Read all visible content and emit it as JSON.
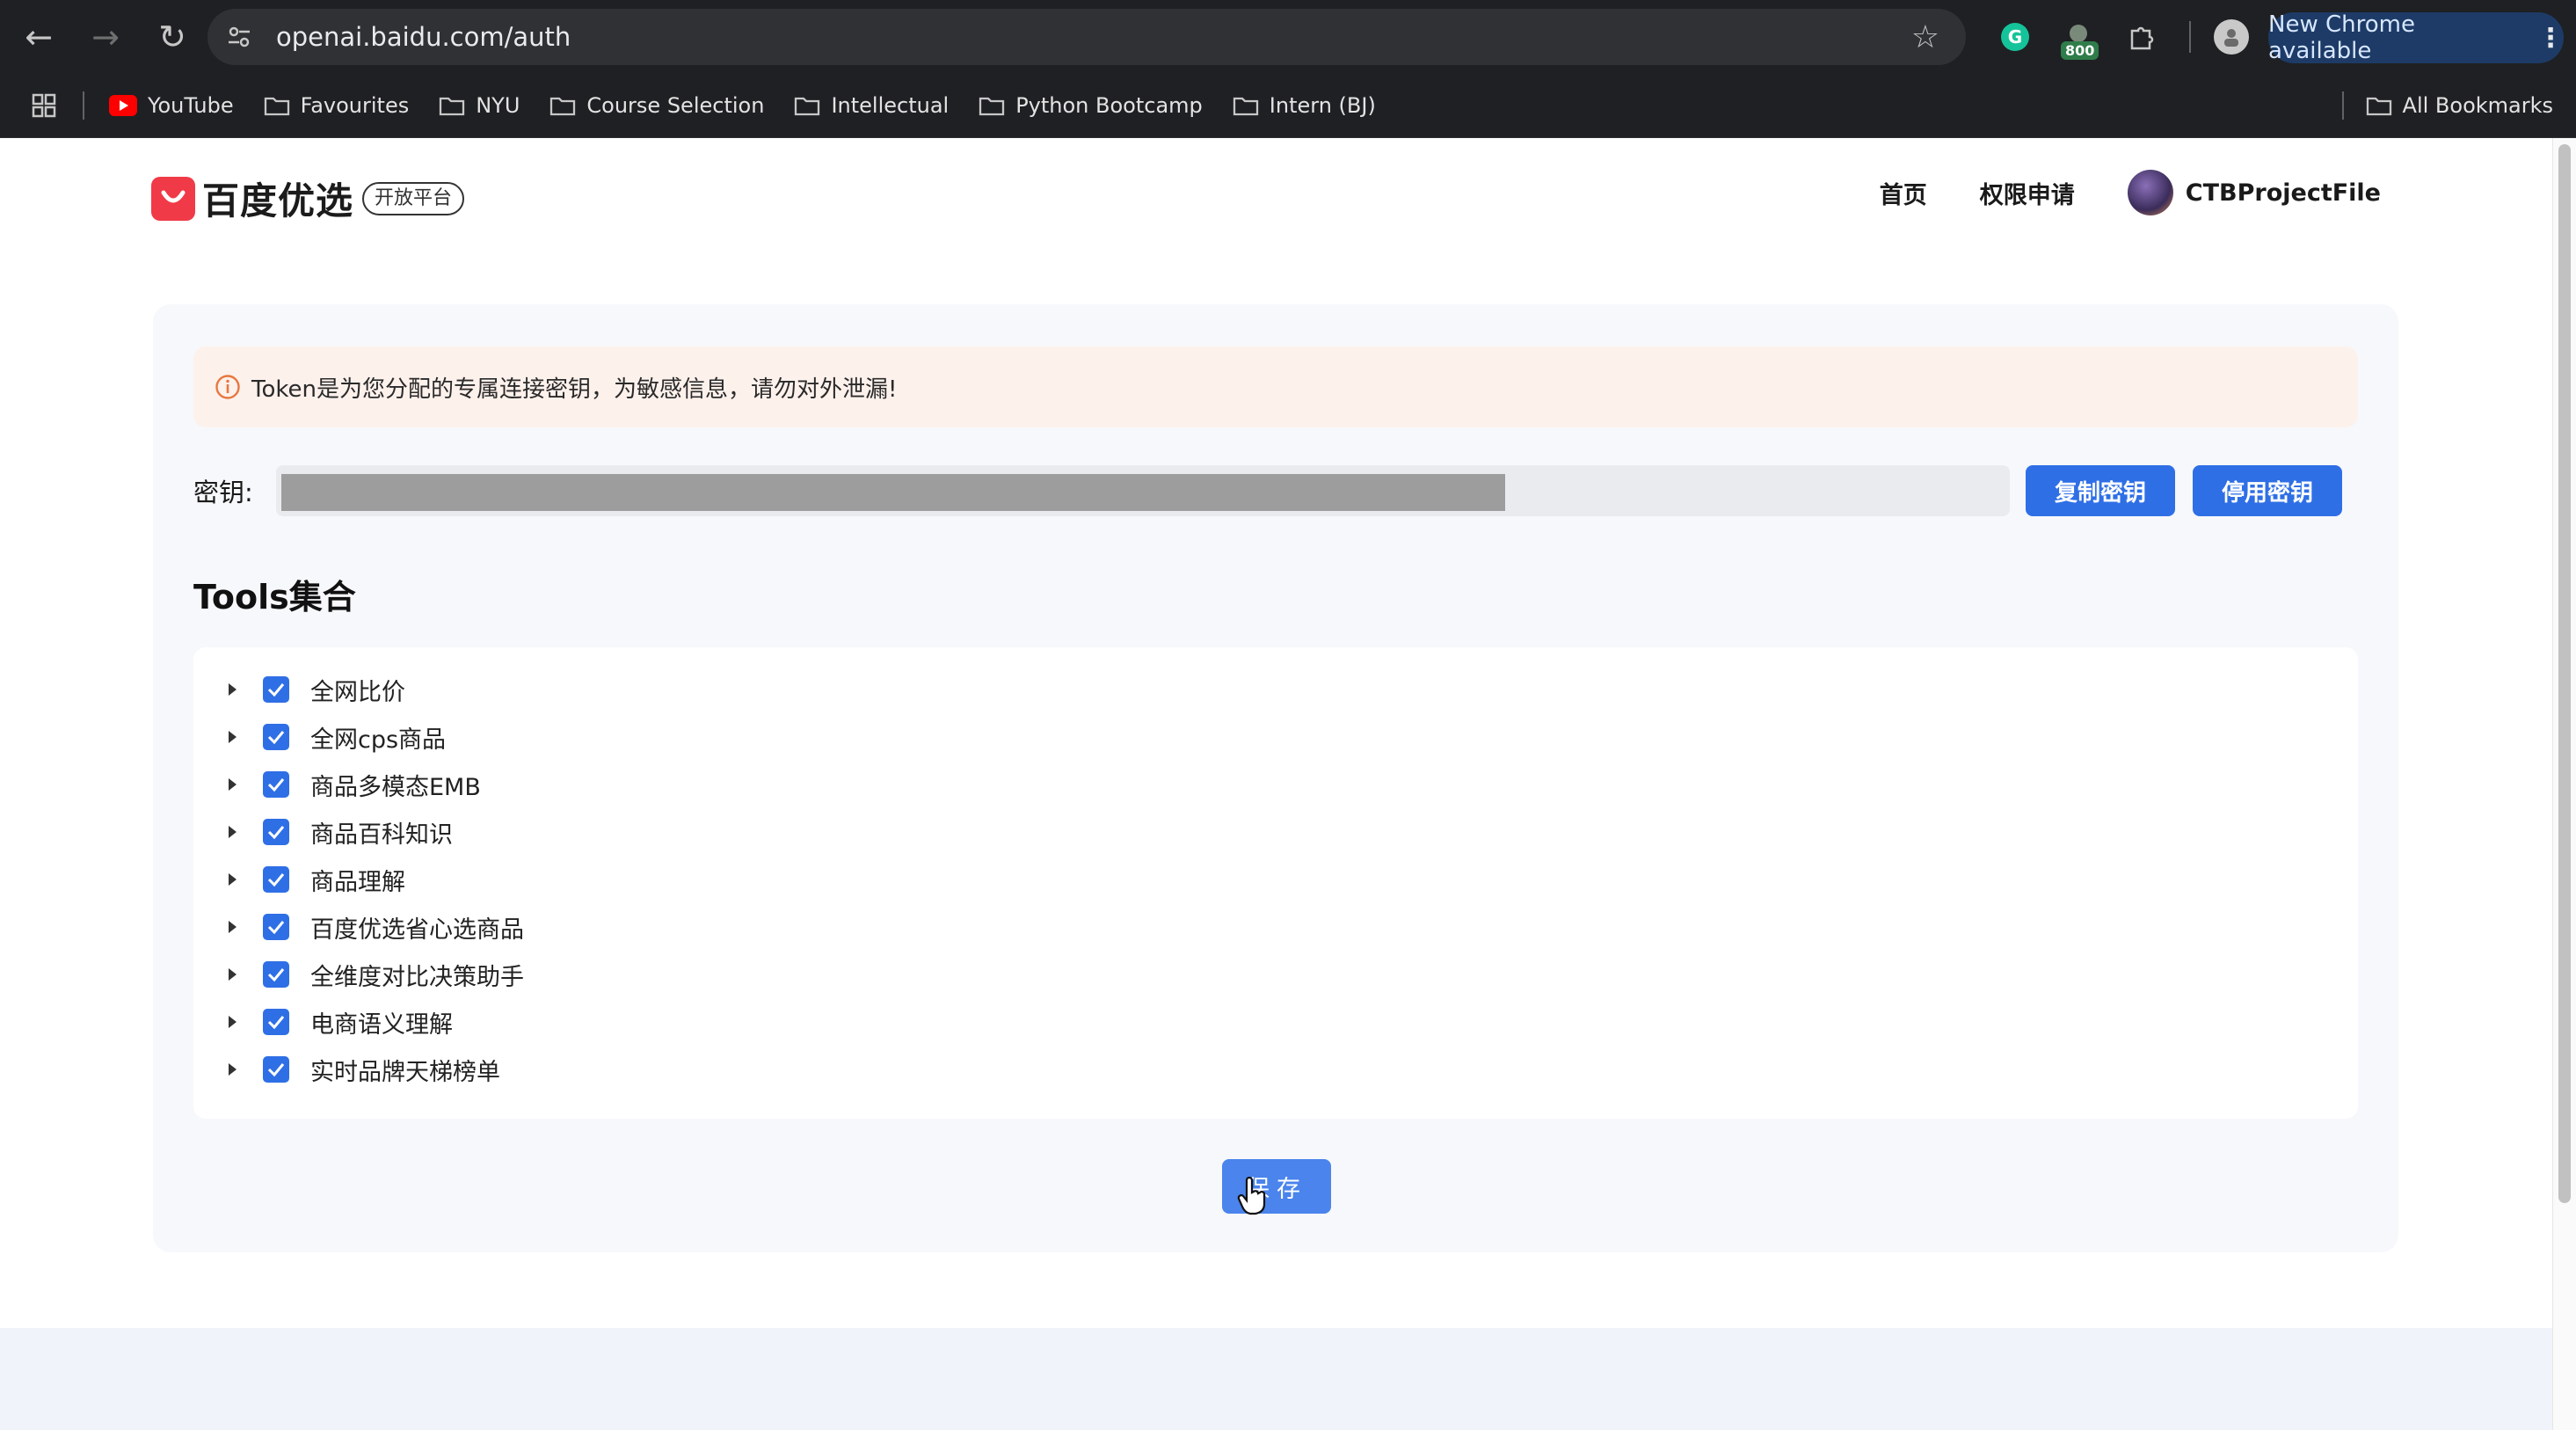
{
  "browser": {
    "url": "openai.baidu.com/auth",
    "update_label": "New Chrome available",
    "extension_badge": "800",
    "bookmarks": [
      "YouTube",
      "Favourites",
      "NYU",
      "Course Selection",
      "Intellectual",
      "Python Bootcamp",
      "Intern (BJ)"
    ],
    "all_bookmarks": "All Bookmarks"
  },
  "header": {
    "logo_text": "百度优选",
    "logo_tag": "开放平台",
    "nav": [
      "首页",
      "权限申请"
    ],
    "username": "CTBProjectFile"
  },
  "alert": {
    "text": "Token是为您分配的专属连接密钥，为敏感信息，请勿对外泄漏!"
  },
  "key": {
    "label": "密钥:",
    "copy_button": "复制密钥",
    "disable_button": "停用密钥"
  },
  "tools": {
    "title": "Tools集合",
    "items": [
      {
        "label": "全网比价",
        "checked": true
      },
      {
        "label": "全网cps商品",
        "checked": true
      },
      {
        "label": "商品多模态EMB",
        "checked": true
      },
      {
        "label": "商品百科知识",
        "checked": true
      },
      {
        "label": "商品理解",
        "checked": true
      },
      {
        "label": "百度优选省心选商品",
        "checked": true
      },
      {
        "label": "全维度对比决策助手",
        "checked": true
      },
      {
        "label": "电商语义理解",
        "checked": true
      },
      {
        "label": "实时品牌天梯榜单",
        "checked": true
      }
    ]
  },
  "save_button": "保存",
  "colors": {
    "primary": "#2f6fe6",
    "alert_bg": "#fdf1ec",
    "brand_red": "#f03a48"
  }
}
